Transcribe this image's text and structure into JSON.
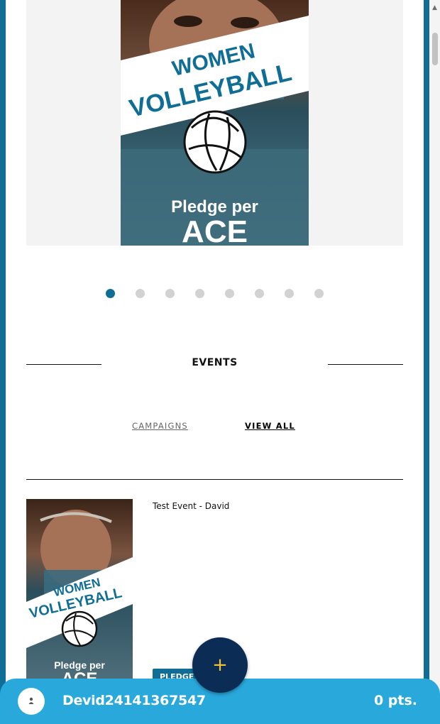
{
  "hero": {
    "poster": {
      "line1": "WOMEN",
      "line2": "VOLLEYBALL",
      "pledge": "Pledge per",
      "ace": "ACE"
    }
  },
  "carousel": {
    "count": 8,
    "active_index": 0
  },
  "events": {
    "heading": "EVENTS",
    "tabs": [
      {
        "label": "CAMPAIGNS",
        "active": false
      },
      {
        "label": "VIEW ALL",
        "active": true
      }
    ],
    "items": [
      {
        "title": "Test Event - David",
        "badge": "PLEDGE",
        "poster": {
          "line1": "WOMEN",
          "line2": "VOLLEYBALL",
          "pledge": "Pledge per",
          "ace": "ACE"
        }
      }
    ]
  },
  "fab": {
    "icon": "plus-icon",
    "glyph": "+"
  },
  "user_bar": {
    "avatar_icon": "user-icon",
    "username": "Devid24141367547",
    "points": "0 pts."
  },
  "colors": {
    "accent": "#0f6d96",
    "bar": "#29a8dc",
    "fab": "#0b2d55",
    "fab_glyph": "#f2c230"
  }
}
